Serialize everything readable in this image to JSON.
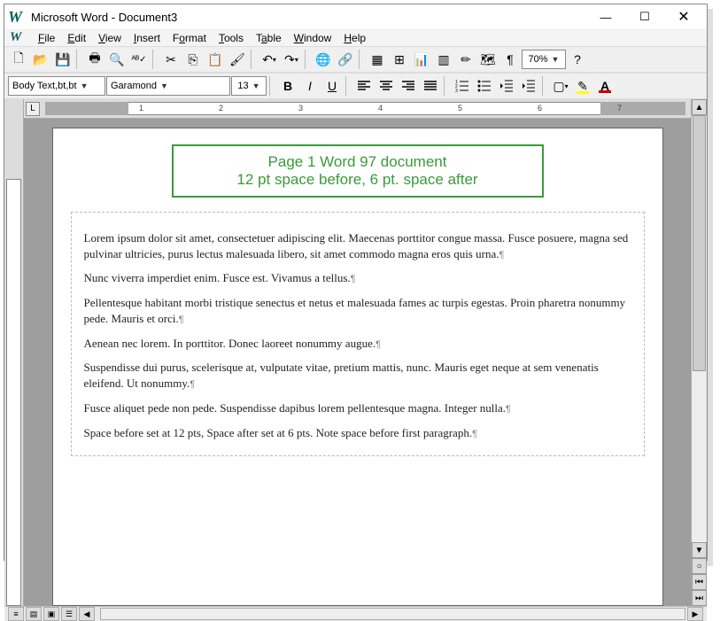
{
  "window": {
    "title": "Microsoft Word - Document3"
  },
  "menu": {
    "file": "File",
    "edit": "Edit",
    "view": "View",
    "insert": "Insert",
    "format": "Format",
    "tools": "Tools",
    "table": "Table",
    "window": "Window",
    "help": "Help"
  },
  "toolbar": {
    "zoom": "70%"
  },
  "format_bar": {
    "style": "Body Text,bt,bt",
    "font": "Garamond",
    "size": "13"
  },
  "ruler": {
    "ticks": [
      "1",
      "2",
      "3",
      "4",
      "5",
      "6",
      "7"
    ]
  },
  "callout": {
    "line1": "Page 1 Word 97 document",
    "line2": "12 pt space before, 6 pt. space after"
  },
  "document": {
    "paragraphs": [
      "Lorem ipsum dolor sit amet, consectetuer adipiscing elit. Maecenas porttitor congue massa. Fusce posuere, magna sed pulvinar ultricies, purus lectus malesuada libero, sit amet commodo magna eros quis urna.",
      "Nunc viverra imperdiet enim. Fusce est. Vivamus a tellus.",
      "Pellentesque habitant morbi tristique senectus et netus et malesuada fames ac turpis egestas. Proin pharetra nonummy pede. Mauris et orci.",
      "Aenean nec lorem. In porttitor. Donec laoreet nonummy augue.",
      "Suspendisse dui purus, scelerisque at, vulputate vitae, pretium mattis, nunc. Mauris eget neque at sem venenatis eleifend. Ut nonummy.",
      "Fusce aliquet pede non pede. Suspendisse dapibus lorem pellentesque magna. Integer nulla.",
      "Space before set at 12 pts, Space after set at 6 pts. Note space before first paragraph."
    ]
  },
  "colors": {
    "callout_border": "#3a9a3a",
    "highlight": "#ffff00",
    "font_color": "#cc0000"
  }
}
